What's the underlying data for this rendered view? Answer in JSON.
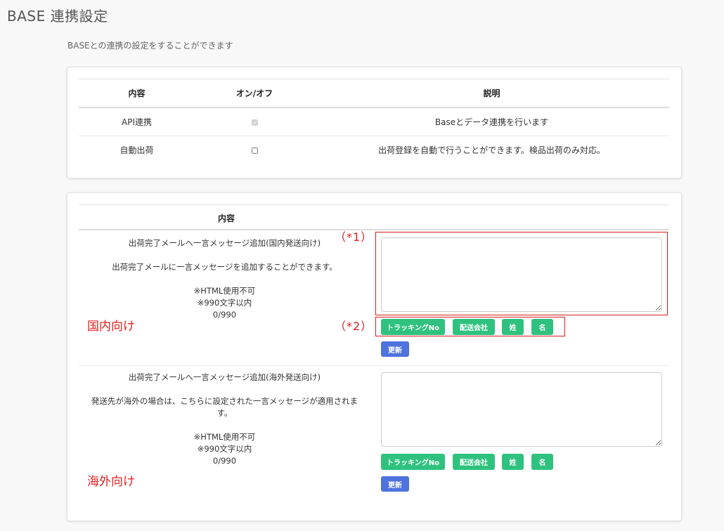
{
  "page": {
    "title": "BASE 連携設定",
    "subtitle": "BASEとの連携の設定をすることができます"
  },
  "settings_table": {
    "headers": [
      "内容",
      "オン/オフ",
      "説明"
    ],
    "rows": [
      {
        "name": "API連携",
        "checked": true,
        "disabled": true,
        "description": "Baseとデータ連携を行います"
      },
      {
        "name": "自動出荷",
        "checked": false,
        "disabled": false,
        "description": "出荷登録を自動で行うことができます。検品出荷のみ対応。"
      }
    ]
  },
  "message_section": {
    "header": "内容",
    "domestic": {
      "title": "出荷完了メールへ一言メッセージ追加(国内発送向け)",
      "description": "出荷完了メールに一言メッセージを追加することができます。",
      "note1": "※HTML使用不可",
      "note2": "※990文字以内",
      "counter": "0/990",
      "value": "",
      "annotation": "国内向け"
    },
    "overseas": {
      "title": "出荷完了メールへ一言メッセージ追加(海外発送向け)",
      "description_line1": "発送先が海外の場合は、こちらに設定された一言メッセージが適用されま",
      "description_line2": "す。",
      "note1": "※HTML使用不可",
      "note2": "※990文字以内",
      "counter": "0/990",
      "value": "",
      "annotation": "海外向け"
    },
    "tag_buttons": [
      "トラッキングNo",
      "配送会社",
      "姓",
      "名"
    ],
    "update_label": "更新"
  },
  "annotations": {
    "note1": "（*1）",
    "note2": "（*2）"
  },
  "colors": {
    "tag_button": "#2ec27e",
    "update_button": "#4e73df",
    "annotation_red": "#e02020"
  }
}
